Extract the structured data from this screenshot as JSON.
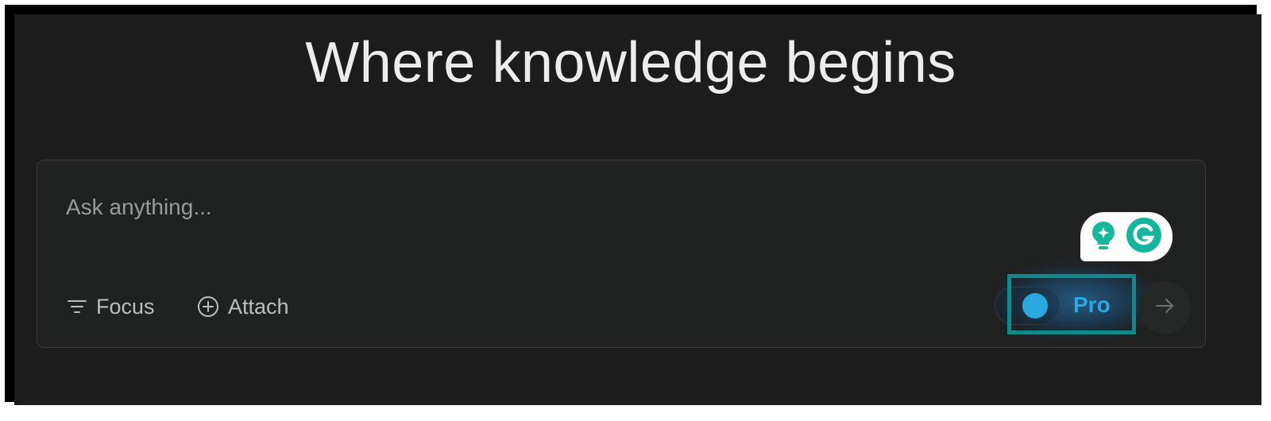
{
  "heading": "Where knowledge begins",
  "search": {
    "placeholder": "Ask anything...",
    "value": ""
  },
  "toolbar": {
    "focus_label": "Focus",
    "attach_label": "Attach",
    "pro_label": "Pro"
  },
  "icons": {
    "focus": "filter-icon",
    "attach": "plus-circle-icon",
    "submit": "arrow-right-icon",
    "grammarly_suggestion": "lightbulb-icon",
    "grammarly": "grammarly-g-icon"
  },
  "colors": {
    "background": "#1c1c1c",
    "panel": "#202121",
    "accent": "#2aa8e0",
    "highlight_box": "#0f8a8c"
  },
  "pro_toggle": {
    "enabled": true
  }
}
